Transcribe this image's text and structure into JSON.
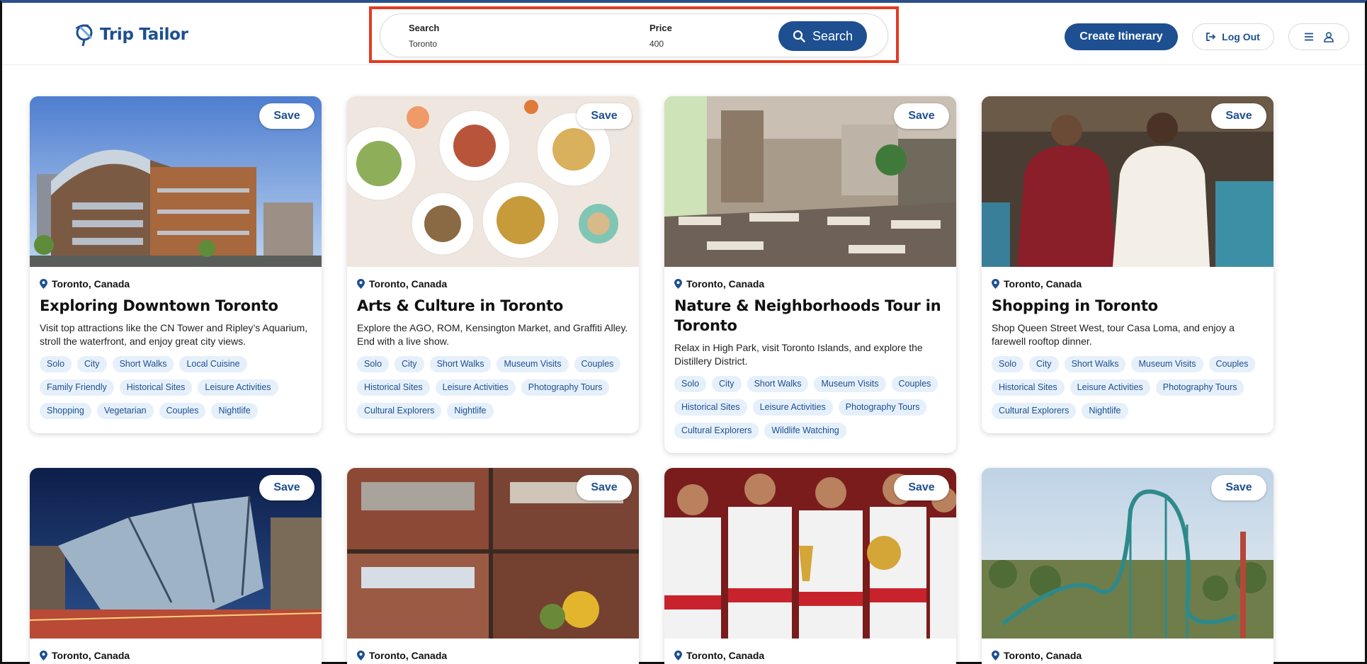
{
  "app": {
    "name": "Trip Tailor"
  },
  "search": {
    "search_label": "Search",
    "search_value": "Toronto",
    "price_label": "Price",
    "price_value": "400",
    "button_label": "Search"
  },
  "header": {
    "create_label": "Create Itinerary",
    "logout_label": "Log Out"
  },
  "cards": [
    {
      "save": "Save",
      "location": "Toronto, Canada",
      "title": "Exploring Downtown Toronto",
      "description": "Visit top attractions like the CN Tower and Ripley’s Aquarium, stroll the waterfront, and enjoy great city views.",
      "tags": [
        "Solo",
        "City",
        "Short Walks",
        "Local Cuisine",
        "Family Friendly",
        "Historical Sites",
        "Leisure Activities",
        "Shopping",
        "Vegetarian",
        "Couples",
        "Nightlife"
      ]
    },
    {
      "save": "Save",
      "location": "Toronto, Canada",
      "title": "Arts & Culture in Toronto",
      "description": "Explore the AGO, ROM, Kensington Market, and Graffiti Alley. End with a live show.",
      "tags": [
        "Solo",
        "City",
        "Short Walks",
        "Museum Visits",
        "Couples",
        "Historical Sites",
        "Leisure Activities",
        "Photography Tours",
        "Cultural Explorers",
        "Nightlife"
      ]
    },
    {
      "save": "Save",
      "location": "Toronto, Canada",
      "title": "Nature & Neighborhoods Tour in Toronto",
      "description": "Relax in High Park, visit Toronto Islands, and explore the Distillery District.",
      "tags": [
        "Solo",
        "City",
        "Short Walks",
        "Museum Visits",
        "Couples",
        "Historical Sites",
        "Leisure Activities",
        "Photography Tours",
        "Cultural Explorers",
        "Wildlife Watching"
      ]
    },
    {
      "save": "Save",
      "location": "Toronto, Canada",
      "title": "Shopping in Toronto",
      "description": "Shop Queen Street West, tour Casa Loma, and enjoy a farewell rooftop dinner.",
      "tags": [
        "Solo",
        "City",
        "Short Walks",
        "Museum Visits",
        "Couples",
        "Historical Sites",
        "Leisure Activities",
        "Photography Tours",
        "Cultural Explorers",
        "Nightlife"
      ]
    },
    {
      "save": "Save",
      "location": "Toronto, Canada"
    },
    {
      "save": "Save",
      "location": "Toronto, Canada"
    },
    {
      "save": "Save",
      "location": "Toronto, Canada"
    },
    {
      "save": "Save",
      "location": "Toronto, Canada"
    }
  ],
  "colors": {
    "brand": "#1d4f91",
    "tag_bg": "#e6f0fb",
    "highlight": "#e23b22"
  }
}
